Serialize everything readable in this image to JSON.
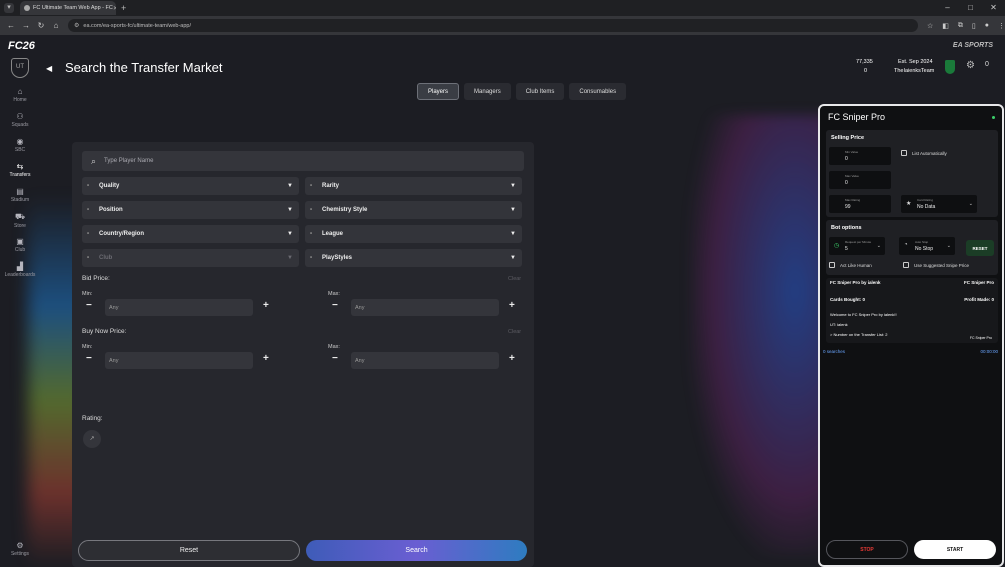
{
  "browser": {
    "tab_title": "FC Ultimate Team Web App - FC",
    "url": "ea.com/ea-sports-fc/ultimate-team/web-app/"
  },
  "header": {
    "logo": "FC26",
    "brand": "EA SPORTS",
    "back": "◀",
    "title": "Search the Transfer Market",
    "coins": "77,335",
    "points": "0",
    "established": "Est. Sep 2024",
    "team_name": "TheIaienksTeam",
    "inventory": "0"
  },
  "sidebar": {
    "ut_badge": "UT",
    "items": [
      {
        "label": "Home",
        "icon": "home-icon"
      },
      {
        "label": "Squads",
        "icon": "squads-icon"
      },
      {
        "label": "SBC",
        "icon": "sbc-icon"
      },
      {
        "label": "Transfers",
        "icon": "transfers-icon"
      },
      {
        "label": "Stadium",
        "icon": "stadium-icon"
      },
      {
        "label": "Store",
        "icon": "store-icon"
      },
      {
        "label": "Club",
        "icon": "club-icon"
      },
      {
        "label": "Leaderboards",
        "icon": "leaderboards-icon"
      },
      {
        "label": "Settings",
        "icon": "settings-icon"
      }
    ]
  },
  "tabs": [
    "Players",
    "Managers",
    "Club Items",
    "Consumables"
  ],
  "search": {
    "placeholder": "Type Player Name",
    "filters": {
      "quality": "Quality",
      "rarity": "Rarity",
      "position": "Position",
      "chemistry": "Chemistry Style",
      "country": "Country/Region",
      "league": "League",
      "club": "Club",
      "playstyles": "PlayStyles"
    },
    "bid_price": "Bid Price:",
    "buy_now_price": "Buy Now Price:",
    "clear": "Clear",
    "min": "Min:",
    "max": "Max:",
    "any": "Any",
    "rating": "Rating:",
    "reset": "Reset",
    "search": "Search"
  },
  "sniper": {
    "title": "FC Sniper Pro",
    "selling_price": "Selling Price",
    "min_value_label": "Min Value",
    "min_value": "0",
    "max_value_label": "Max Value",
    "max_value": "0",
    "max_rating_label": "Max Rating",
    "max_rating": "99",
    "card_rating_label": "Card Rating",
    "card_rating": "No Data",
    "list_auto": "List Automatically",
    "bot_options": "Bot options",
    "req_label": "Request per Minute",
    "req_value": "5",
    "autostop_label": "Auto Stop",
    "autostop_value": "No Stop",
    "reset": "RESET",
    "act_human": "Act Like Human",
    "use_suggested": "Use Suggested Snipe Price",
    "by_label": "FC Sniper Pro by ialenk",
    "brand_right": "FC Sniper Pro",
    "cards_bought": "Cards Bought:",
    "cards_bought_value": "0",
    "profit_made": "Profit Made:",
    "profit_value": "0",
    "welcome": "Welcome to FC Sniper Pro by ialenk!!",
    "ut_user": "UT: ialenk",
    "transfer_list": "> Number on the Transfer List: 2",
    "log_tag": "FC Sniper Pro",
    "searches": "0 searches",
    "timer": "00:00:00",
    "stop": "STOP",
    "start": "START"
  }
}
